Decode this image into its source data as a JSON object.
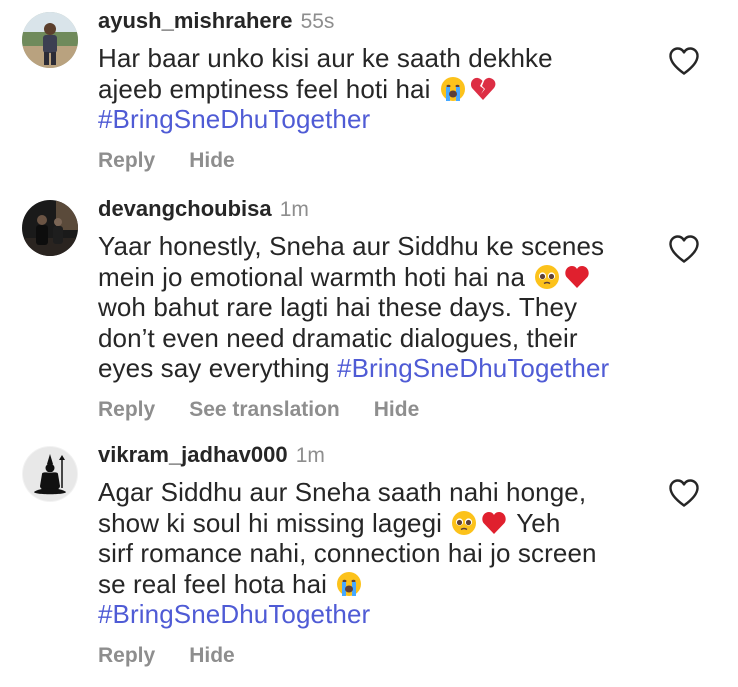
{
  "comments": [
    {
      "username": "ayush_mishrahere",
      "time": "55s",
      "text_lines": [
        "Har baar unko kisi aur ke saath dekhke",
        "ajeeb emptiness feel hoti hai"
      ],
      "hashtag": "#BringSneDhuTogether",
      "emojis": [
        "loudly-crying-face",
        "broken-heart"
      ],
      "actions": [
        "Reply",
        "Hide"
      ]
    },
    {
      "username": "devangchoubisa",
      "time": "1m",
      "text_lines": [
        "Yaar honestly, Sneha aur Siddhu ke scenes",
        "mein jo emotional warmth hoti hai na",
        "woh bahut rare lagti hai these days. They",
        "don’t even need dramatic dialogues, their",
        "eyes say everything"
      ],
      "hashtag": "#BringSneDhuTogether",
      "emojis": [
        "pleading-face",
        "red-heart"
      ],
      "actions": [
        "Reply",
        "See translation",
        "Hide"
      ]
    },
    {
      "username": "vikram_jadhav000",
      "time": "1m",
      "text_lines": [
        "Agar Siddhu aur Sneha saath nahi honge,",
        "show ki soul hi missing lagegi",
        "Yeh",
        "sirf romance nahi, connection hai jo screen",
        "se real feel hota hai"
      ],
      "hashtag": "#BringSneDhuTogether",
      "emojis": [
        "pleading-face",
        "red-heart",
        "loudly-crying-face"
      ],
      "actions": [
        "Reply",
        "Hide"
      ]
    }
  ],
  "colors": {
    "username": "#262626",
    "meta": "#8e8e8e",
    "hashtag": "#4f5bd5",
    "heart_outline": "#262626"
  },
  "icons": {
    "like": "heart-outline-icon"
  }
}
